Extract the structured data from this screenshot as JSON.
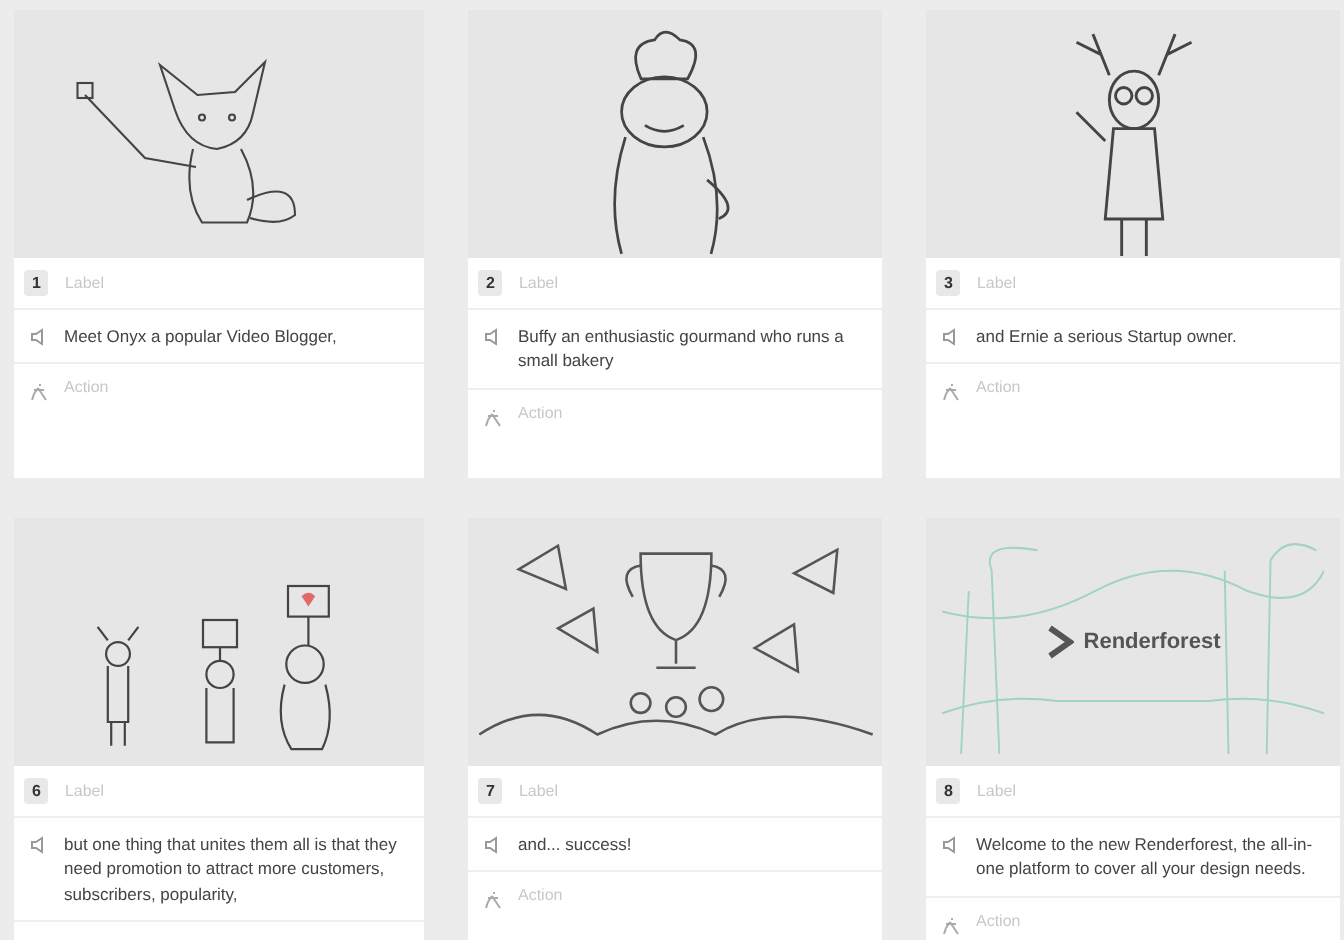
{
  "scenes": [
    {
      "number": "1",
      "label": "Label",
      "narration": "Meet Onyx a popular Video Blogger,",
      "action": "Action",
      "frame": {
        "kind": "fox"
      }
    },
    {
      "number": "2",
      "label": "Label",
      "narration": "Buffy an enthusiastic gourmand who runs a small bakery",
      "action": "Action",
      "frame": {
        "kind": "bear"
      }
    },
    {
      "number": "3",
      "label": "Label",
      "narration": "and Ernie a serious Startup owner.",
      "action": "Action",
      "frame": {
        "kind": "deer"
      }
    },
    {
      "number": "6",
      "label": "Label",
      "narration": "but one thing that unites them all is that they need promotion to attract more customers, subscribers, popularity,",
      "frame": {
        "kind": "group"
      }
    },
    {
      "number": "7",
      "label": "Label",
      "narration": "and... success!",
      "action": "Action",
      "frame": {
        "kind": "trophy"
      }
    },
    {
      "number": "8",
      "label": "Label",
      "narration": "Welcome to the new Renderforest, the all-in-one platform to cover all your design needs.",
      "action": "Action",
      "frame": {
        "kind": "logo",
        "text": "Renderforest"
      }
    }
  ]
}
